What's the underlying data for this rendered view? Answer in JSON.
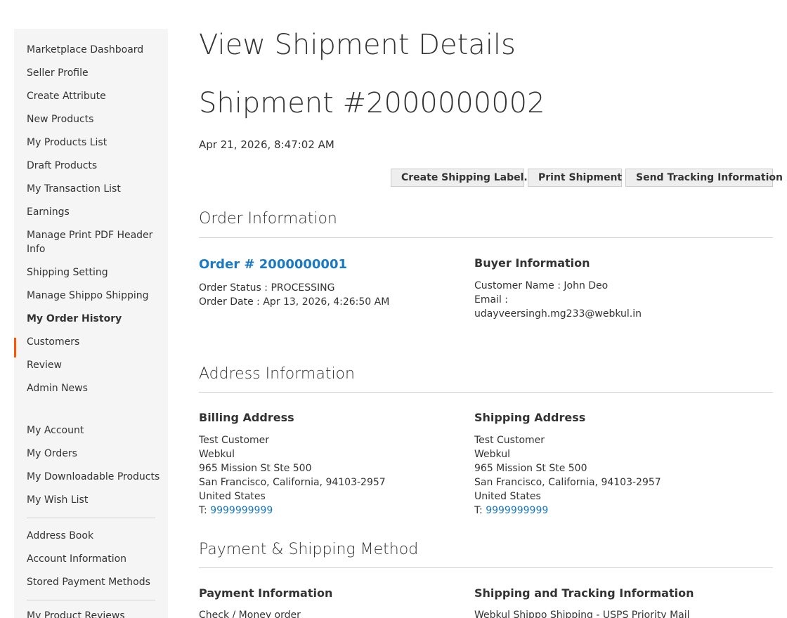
{
  "sidebar": {
    "group1": [
      {
        "label": "Marketplace Dashboard"
      },
      {
        "label": "Seller Profile"
      },
      {
        "label": "Create Attribute"
      },
      {
        "label": "New Products"
      },
      {
        "label": "My Products List"
      },
      {
        "label": "Draft Products"
      },
      {
        "label": "My Transaction List"
      },
      {
        "label": "Earnings"
      },
      {
        "label": "Manage Print PDF Header Info"
      },
      {
        "label": "Shipping Setting"
      },
      {
        "label": "Manage Shippo Shipping"
      },
      {
        "label": "My Order History",
        "active": true
      },
      {
        "label": "Customers"
      },
      {
        "label": "Review"
      },
      {
        "label": "Admin News"
      }
    ],
    "group2": [
      {
        "label": "My Account"
      },
      {
        "label": "My Orders"
      },
      {
        "label": "My Downloadable Products"
      },
      {
        "label": "My Wish List"
      }
    ],
    "group3": [
      {
        "label": "Address Book"
      },
      {
        "label": "Account Information"
      },
      {
        "label": "Stored Payment Methods"
      }
    ],
    "group4": [
      {
        "label": "My Product Reviews"
      }
    ],
    "accent_color": "#ff5501"
  },
  "page": {
    "title": "View Shipment Details",
    "shipment_title": "Shipment #2000000002",
    "shipment_date": "Apr 21, 2026, 8:47:02 AM"
  },
  "actions": {
    "create_label": "Create Shipping Label...",
    "print_shipment": "Print Shipment",
    "send_tracking": "Send Tracking Information"
  },
  "order_info": {
    "section_title": "Order Information",
    "order_link": "Order # 2000000001",
    "order_status": "Order Status : PROCESSING",
    "order_date": "Order Date : Apr 13, 2026, 4:26:50 AM",
    "buyer_heading": "Buyer Information",
    "customer_name": "Customer Name : John Deo",
    "email_label": "Email :",
    "email_value": "udayveersingh.mg233@webkul.in"
  },
  "address_info": {
    "section_title": "Address Information",
    "billing": {
      "heading": "Billing Address",
      "name": "Test Customer",
      "company": "Webkul",
      "street": "965 Mission St Ste 500",
      "city_line": "San Francisco, California, 94103-2957",
      "country": "United States",
      "phone_prefix": "T: ",
      "phone": "9999999999"
    },
    "shipping": {
      "heading": "Shipping Address",
      "name": "Test Customer",
      "company": "Webkul",
      "street": "965 Mission St Ste 500",
      "city_line": "San Francisco, California, 94103-2957",
      "country": "United States",
      "phone_prefix": "T: ",
      "phone": "9999999999"
    }
  },
  "payment_shipping": {
    "section_title": "Payment & Shipping Method",
    "payment_heading": "Payment Information",
    "payment_method": "Check / Money order",
    "shipping_heading": "Shipping and Tracking Information",
    "shipping_method": "Webkul Shippo Shipping - USPS Priority Mail"
  },
  "colors": {
    "link": "#1979c3",
    "text": "#333333",
    "sidebar_bg": "#f5f5f5"
  }
}
